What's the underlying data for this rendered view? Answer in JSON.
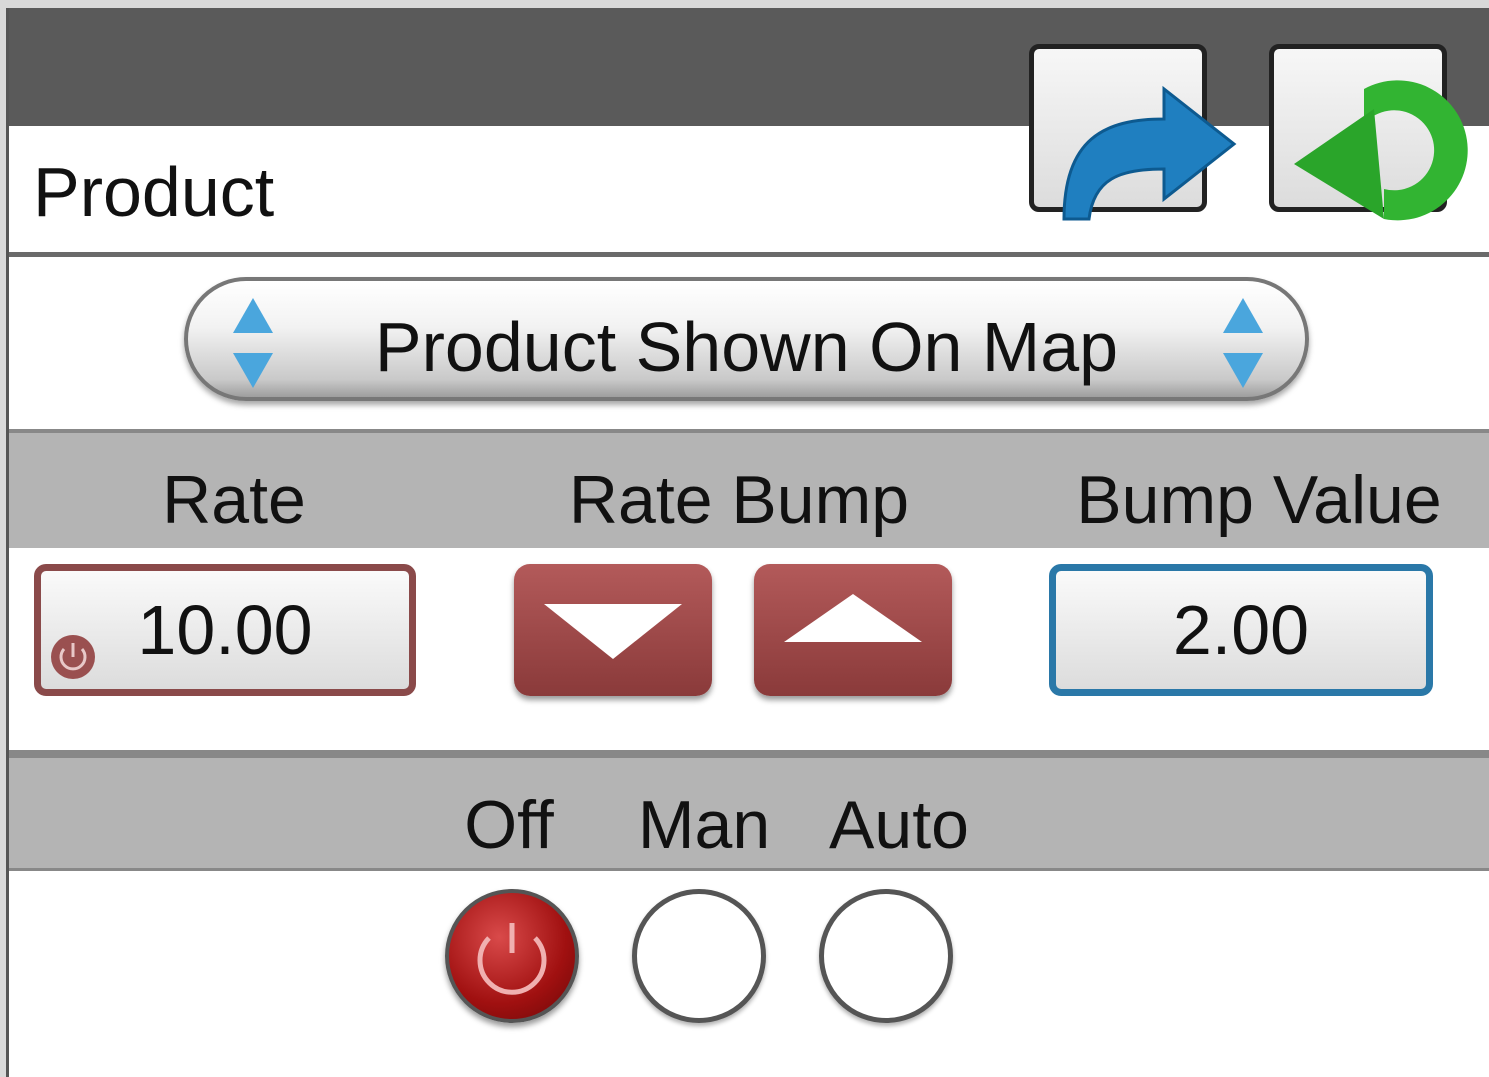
{
  "panel": {
    "title": "Product",
    "buttons": {
      "forward_icon": "forward-arrow-icon",
      "back_icon": "return-arrow-icon"
    }
  },
  "selector": {
    "value": "Product Shown On Map"
  },
  "headers": {
    "rate": "Rate",
    "rate_bump": "Rate Bump",
    "bump_value": "Bump Value"
  },
  "rate": {
    "value": "10.00"
  },
  "bump": {
    "value": "2.00"
  },
  "mode": {
    "labels": [
      "Off",
      "Man",
      "Auto"
    ],
    "selected": "Off"
  },
  "colors": {
    "accent_blue": "#2a78a8",
    "rate_red": "#8a3a3a",
    "off_red": "#a01010",
    "header_gray": "#b4b4b4"
  }
}
